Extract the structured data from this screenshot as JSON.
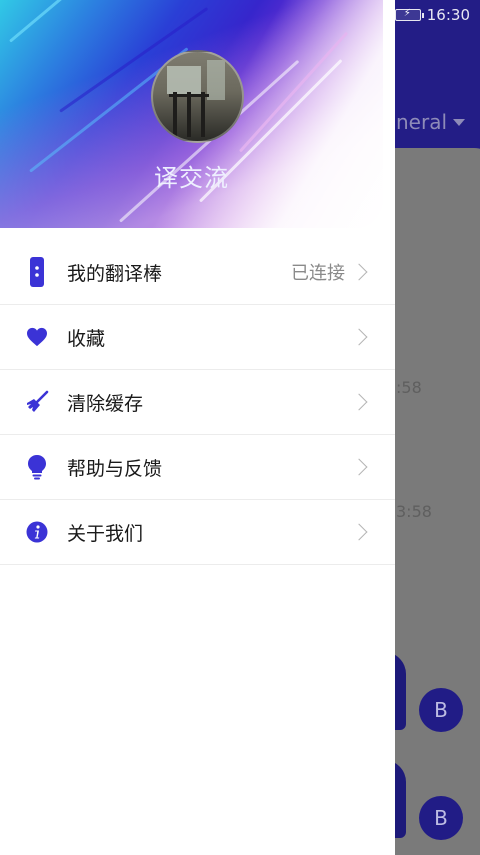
{
  "status_bar": {
    "time": "16:30",
    "battery_icon": "battery-charging-icon"
  },
  "background": {
    "language_selector": "neral",
    "timestamps": [
      ":58",
      "3:58"
    ],
    "avatar_letters": [
      "B",
      "B"
    ]
  },
  "drawer": {
    "app_name": "译交流",
    "menu": [
      {
        "label": "我的翻译棒",
        "value": "已连接",
        "icon": "translator-device-icon"
      },
      {
        "label": "收藏",
        "value": "",
        "icon": "heart-icon"
      },
      {
        "label": "清除缓存",
        "value": "",
        "icon": "broom-icon"
      },
      {
        "label": "帮助与反馈",
        "value": "",
        "icon": "lightbulb-icon"
      },
      {
        "label": "关于我们",
        "value": "",
        "icon": "info-icon"
      }
    ]
  },
  "colors": {
    "accent": "#3b33d6",
    "header_bg": "#231d86"
  }
}
